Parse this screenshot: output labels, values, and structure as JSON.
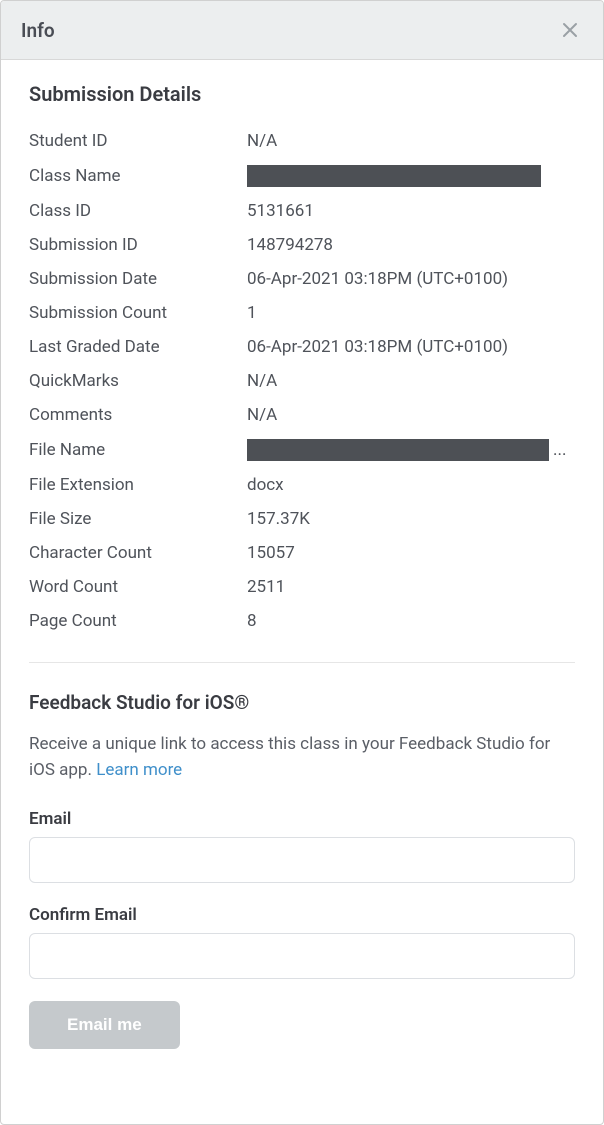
{
  "modal": {
    "title": "Info"
  },
  "submission": {
    "heading": "Submission Details",
    "rows": [
      {
        "label": "Student ID",
        "value": "N/A"
      },
      {
        "label": "Class Name",
        "value": "",
        "redacted": true,
        "rw": "w1"
      },
      {
        "label": "Class ID",
        "value": "5131661"
      },
      {
        "label": "Submission ID",
        "value": "148794278"
      },
      {
        "label": "Submission Date",
        "value": "06-Apr-2021 03:18PM (UTC+0100)"
      },
      {
        "label": "Submission Count",
        "value": "1"
      },
      {
        "label": "Last Graded Date",
        "value": "06-Apr-2021 03:18PM (UTC+0100)"
      },
      {
        "label": "QuickMarks",
        "value": "N/A"
      },
      {
        "label": "Comments",
        "value": "N/A"
      },
      {
        "label": "File Name",
        "value": "",
        "redacted": true,
        "rw": "w2",
        "ellipsis": "..."
      },
      {
        "label": "File Extension",
        "value": "docx"
      },
      {
        "label": "File Size",
        "value": "157.37K"
      },
      {
        "label": "Character Count",
        "value": "15057"
      },
      {
        "label": "Word Count",
        "value": "2511"
      },
      {
        "label": "Page Count",
        "value": "8"
      }
    ]
  },
  "ios": {
    "heading": "Feedback Studio for iOS®",
    "desc_prefix": "Receive a unique link to access this class in your Feedback Studio for iOS app. ",
    "learn_more": "Learn more",
    "email_label": "Email",
    "confirm_label": "Confirm Email",
    "button": "Email me"
  }
}
